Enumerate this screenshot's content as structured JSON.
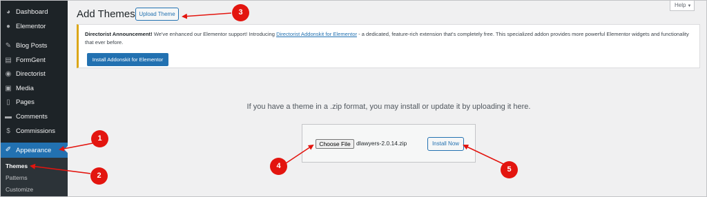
{
  "sidebar": {
    "items": [
      {
        "label": "Dashboard",
        "icon": "dashboard-icon"
      },
      {
        "label": "Elementor",
        "icon": "elementor-icon"
      },
      {
        "label": "Blog Posts",
        "icon": "pin-icon"
      },
      {
        "label": "FormGent",
        "icon": "form-icon"
      },
      {
        "label": "Directorist",
        "icon": "directorist-icon"
      },
      {
        "label": "Media",
        "icon": "media-icon"
      },
      {
        "label": "Pages",
        "icon": "pages-icon"
      },
      {
        "label": "Comments",
        "icon": "comments-icon"
      },
      {
        "label": "Commissions",
        "icon": "dollar-icon"
      },
      {
        "label": "Appearance",
        "icon": "brush-icon"
      }
    ],
    "submenu": [
      "Themes",
      "Patterns",
      "Customize"
    ]
  },
  "header": {
    "title": "Add Themes",
    "upload_label": "Upload Theme",
    "help_label": "Help"
  },
  "notice": {
    "title": "Directorist Announcement!",
    "text_before_link": " We've enhanced our Elementor support! Introducing ",
    "link_text": "Directorist Addonskit for Elementor",
    "text_after_link": " - a dedicated, feature-rich extension that's completely free. This specialized addon provides more powerful Elementor widgets and functionality that ever before.",
    "button_label": "Install Addonskit for Elementor"
  },
  "upload": {
    "help_text": "If you have a theme in a .zip format, you may install or update it by uploading it here.",
    "choose_label": "Choose File",
    "file_name": "dlawyers-2.0.14.zip",
    "install_label": "Install Now"
  },
  "annotations": [
    "1",
    "2",
    "3",
    "4",
    "5"
  ],
  "colors": {
    "sidebar_bg": "#1d2327",
    "active": "#2271b1",
    "notice_border": "#dba617",
    "annotation": "#e3150f"
  }
}
